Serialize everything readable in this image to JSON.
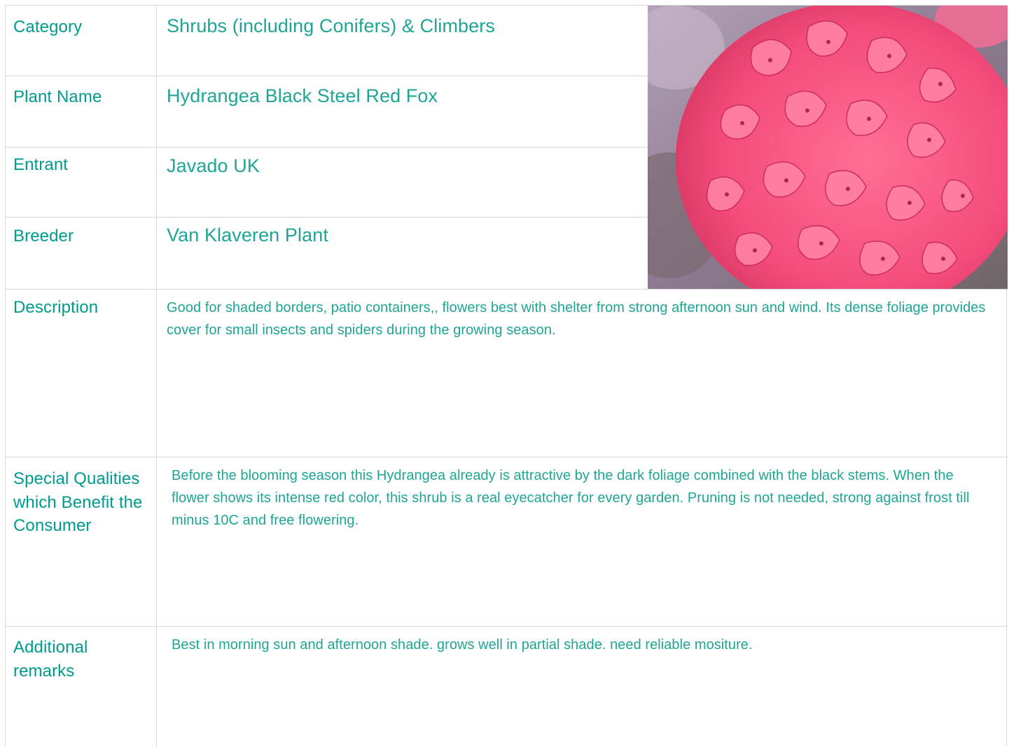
{
  "rows": {
    "category": {
      "label": "Category",
      "value": "Shrubs (including Conifers) & Climbers"
    },
    "plant_name": {
      "label": "Plant Name",
      "value": "Hydrangea Black Steel Red Fox"
    },
    "entrant": {
      "label": "Entrant",
      "value": "Javado UK"
    },
    "breeder": {
      "label": "Breeder",
      "value": "Van Klaveren Plant"
    },
    "description": {
      "label": "Description",
      "value": "Good for shaded borders, patio containers,, flowers best with shelter from strong afternoon sun and wind. Its dense foliage provides cover for small insects and spiders during the growing season."
    },
    "special_qualities": {
      "label": "Special Qualities which Benefit the Consumer",
      "value": "Before the blooming season this Hydrangea already is attractive by the dark foliage combined with the black stems. When the flower shows its intense red color, this shrub is a real eyecatcher for every garden. Pruning is not needed, strong against frost till minus 10C and free flowering."
    },
    "additional_remarks": {
      "label": "Additional remarks",
      "value": "Best in morning sun and afternoon shade. grows well in partial shade. need reliable mositure."
    }
  },
  "photo": {
    "icon": "hydrangea-photo"
  },
  "colors": {
    "label": "#009b8f",
    "value": "#1fa595",
    "border": "#d9d9d9",
    "petal": "#f0507d"
  }
}
